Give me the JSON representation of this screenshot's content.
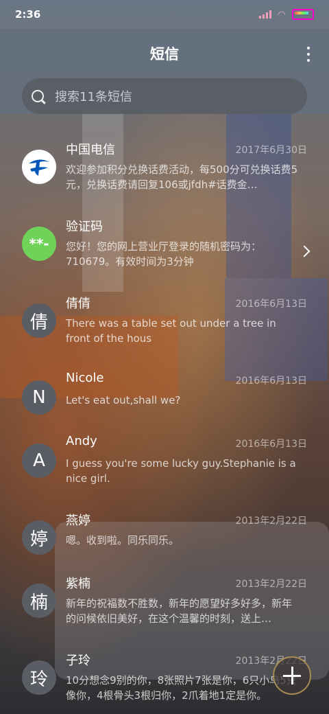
{
  "status_bar": {
    "time": "2:36"
  },
  "app_bar": {
    "title": "短信",
    "more_icon": "more-vertical-icon"
  },
  "search": {
    "placeholder": "搜索11条短信",
    "icon": "search-icon"
  },
  "conversations": [
    {
      "name": "中国电信",
      "avatar": "telecom-logo",
      "date": "2017年6月30日",
      "preview": "欢迎参加积分兑换话费活动，每500分可兑换话费5元，兑换话费请回复106或jfdh#话费金…"
    },
    {
      "name": "验证码",
      "avatar": "**-",
      "date": "",
      "preview": "您好！您的网上营业厅登录的随机密码为：710679。有效时间为3分钟"
    },
    {
      "name": "倩倩",
      "avatar": "倩",
      "date": "2016年6月13日",
      "preview": "There was a table set out under a tree in front of the hous"
    },
    {
      "name": "Nicole",
      "avatar": "N",
      "date": "2016年6月13日",
      "preview": "Let's eat out,shall we?"
    },
    {
      "name": "Andy",
      "avatar": "A",
      "date": "2016年6月13日",
      "preview": "I guess you're some lucky guy.Stephanie is a nice girl."
    },
    {
      "name": "燕婷",
      "avatar": "婷",
      "date": "2013年2月22日",
      "preview": "嗯。收到啦。同乐同乐。"
    },
    {
      "name": "紫楠",
      "avatar": "楠",
      "date": "2013年2月22日",
      "preview": "新年的祝福数不胜数，新年的愿望好多好多，新年的问候依旧美好，在这个温馨的时刻，送上…"
    },
    {
      "name": "子玲",
      "avatar": "玲",
      "date": "2013年2月22日",
      "preview": "10分想念9别的你，8张照片7张是你，6只小鸟5只像你，4根骨头3根归你，2爪着地1定是你。"
    }
  ],
  "fab": {
    "icon": "plus-icon"
  }
}
